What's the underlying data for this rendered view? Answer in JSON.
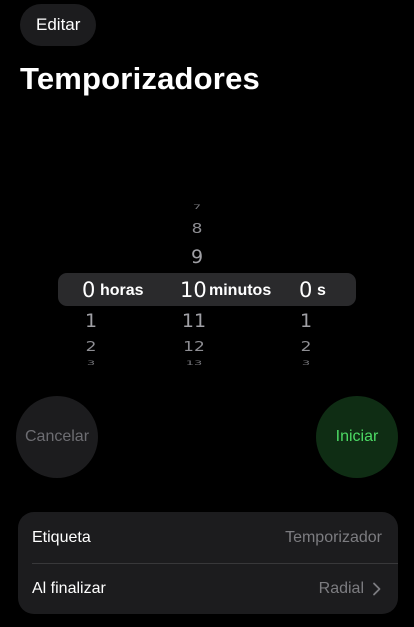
{
  "header": {
    "edit_label": "Editar",
    "title": "Temporizadores"
  },
  "picker": {
    "hours": {
      "selected": "0",
      "unit": "horas",
      "below": [
        "1",
        "2",
        "3"
      ]
    },
    "minutes": {
      "above": [
        "7",
        "8",
        "9"
      ],
      "selected": "10",
      "unit": "minutos",
      "below": [
        "11",
        "12",
        "13"
      ]
    },
    "seconds": {
      "selected": "0",
      "unit": "s",
      "below": [
        "1",
        "2",
        "3"
      ]
    }
  },
  "buttons": {
    "cancel_label": "Cancelar",
    "start_label": "Iniciar"
  },
  "settings": {
    "label_row": {
      "label": "Etiqueta",
      "placeholder": "Temporizador"
    },
    "end_row": {
      "label": "Al finalizar",
      "value": "Radial"
    }
  },
  "colors": {
    "background": "#000000",
    "surface": "#1c1c1e",
    "start_text": "#4cd964",
    "start_bg": "#0f2d14",
    "cancel_text": "#6d6d72",
    "secondary_text": "#7c7c80"
  },
  "icons": {
    "end_row_chevron": "chevron-right-icon"
  }
}
